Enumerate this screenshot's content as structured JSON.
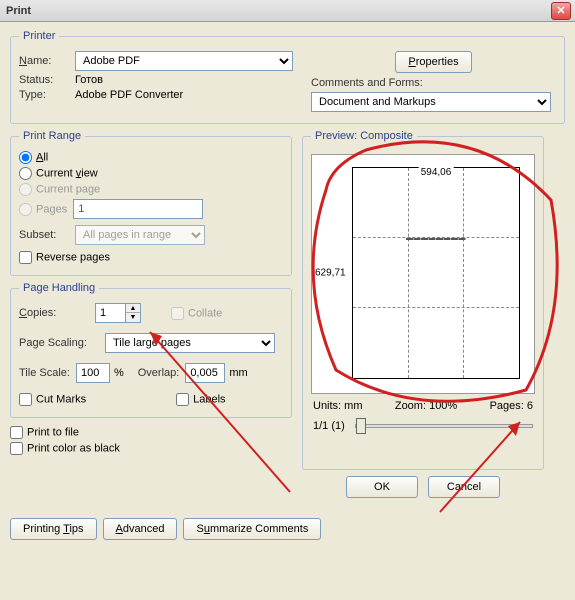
{
  "window": {
    "title": "Print"
  },
  "printer": {
    "legend": "Printer",
    "name_label": "Name:",
    "name_value": "Adobe PDF",
    "status_label": "Status:",
    "status_value": "Готов",
    "type_label": "Type:",
    "type_value": "Adobe PDF Converter",
    "properties_btn": "Properties",
    "comments_label": "Comments and Forms:",
    "comments_value": "Document and Markups"
  },
  "range": {
    "legend": "Print Range",
    "all": "All",
    "current_view": "Current view",
    "current_page": "Current page",
    "pages": "Pages",
    "pages_value": "1",
    "subset_label": "Subset:",
    "subset_value": "All pages in range",
    "reverse": "Reverse pages"
  },
  "handling": {
    "legend": "Page Handling",
    "copies_label": "Copies:",
    "copies_value": "1",
    "collate": "Collate",
    "scaling_label": "Page Scaling:",
    "scaling_value": "Tile large pages",
    "tilescale_label": "Tile Scale:",
    "tilescale_value": "100",
    "tilescale_unit": "%",
    "overlap_label": "Overlap:",
    "overlap_value": "0,005",
    "overlap_unit": "mm",
    "cutmarks": "Cut Marks",
    "labels": "Labels"
  },
  "preview": {
    "legend": "Preview: Composite",
    "width": "594,06",
    "height": "629,71",
    "units": "Units: mm",
    "zoom": "Zoom: 100%",
    "pages": "Pages: 6",
    "progress": "1/1 (1)"
  },
  "footer": {
    "print_to_file": "Print to file",
    "print_color_black": "Print color as black",
    "printing_tips": "Printing Tips",
    "advanced": "Advanced",
    "summarize": "Summarize Comments",
    "ok": "OK",
    "cancel": "Cancel"
  }
}
